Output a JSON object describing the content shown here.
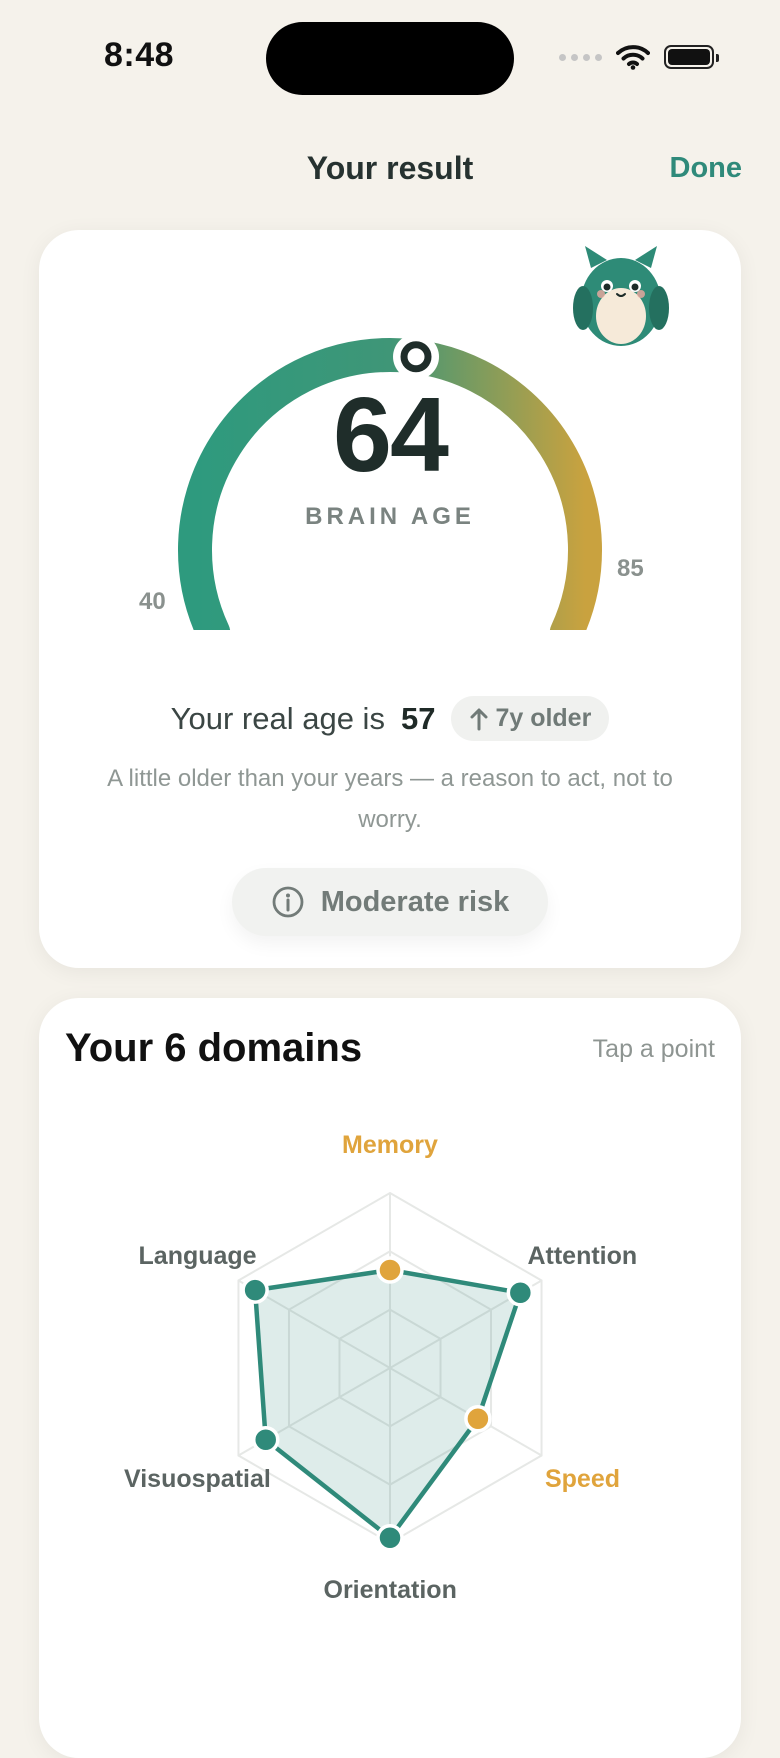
{
  "status_bar": {
    "time": "8:48"
  },
  "nav": {
    "title": "Your result",
    "done_label": "Done"
  },
  "result": {
    "brain_age": "64",
    "brain_age_label": "BRAIN AGE",
    "gauge_min": "40",
    "gauge_max": "85",
    "gauge_value": 64,
    "real_age_prefix": "Your real age is",
    "real_age": "57",
    "older_badge": "7y older",
    "explanation": "A little older than your years — a reason to act, not to worry.",
    "risk_label": "Moderate risk"
  },
  "domains": {
    "title": "Your 6 domains",
    "hint": "Tap a point",
    "axes": [
      {
        "name": "Memory",
        "score": 0.56,
        "highlight": true
      },
      {
        "name": "Attention",
        "score": 0.86,
        "highlight": false
      },
      {
        "name": "Speed",
        "score": 0.58,
        "highlight": true
      },
      {
        "name": "Orientation",
        "score": 0.97,
        "highlight": false
      },
      {
        "name": "Visuospatial",
        "score": 0.82,
        "highlight": false
      },
      {
        "name": "Language",
        "score": 0.89,
        "highlight": false
      }
    ]
  },
  "colors": {
    "accent": "#2f8a7a",
    "highlight": "#e0a43c",
    "gauge_start": "#2e9a7e",
    "gauge_end": "#c9a23f"
  }
}
